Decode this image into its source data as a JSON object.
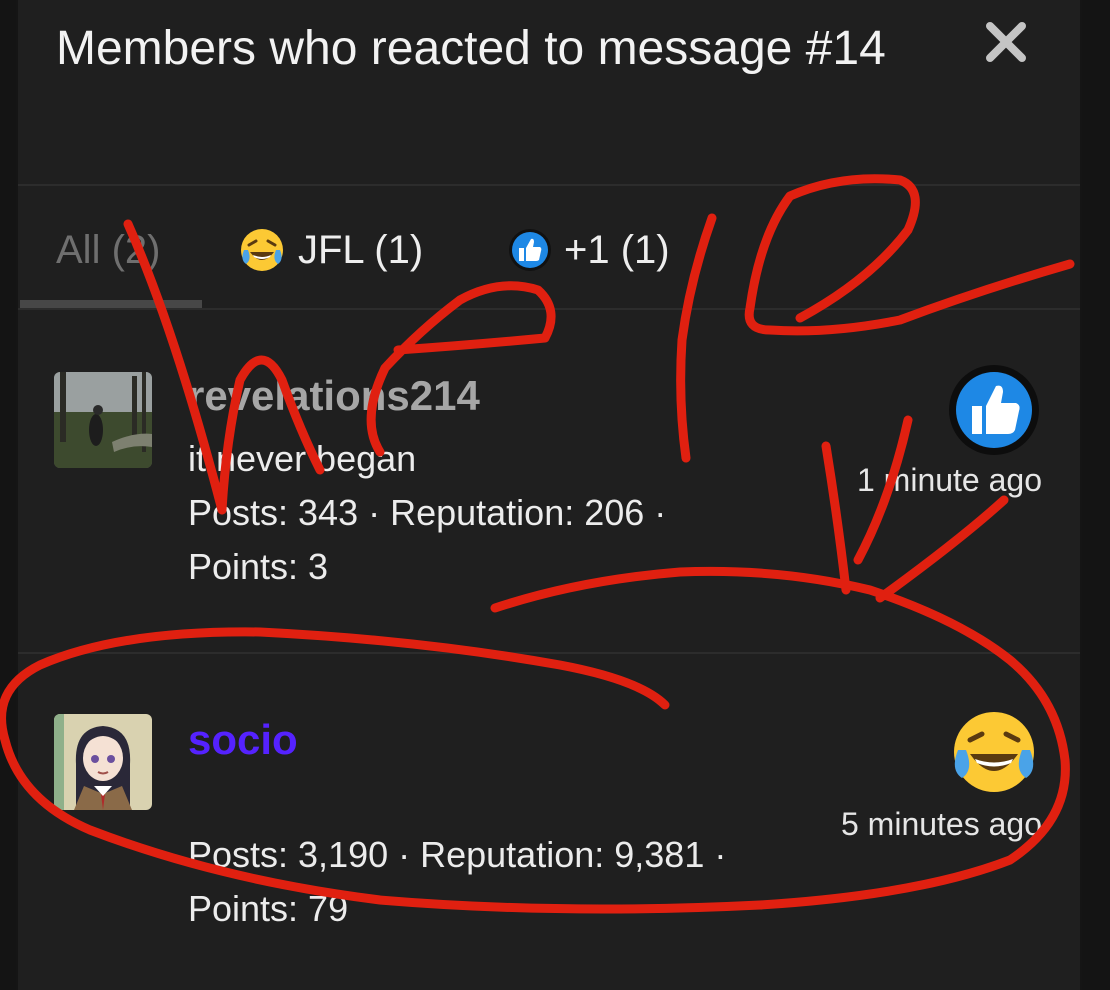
{
  "dialog": {
    "title": "Members who reacted to message #14",
    "close_icon": "close-icon"
  },
  "tabs": [
    {
      "label": "All (2)",
      "icon": null,
      "active": true
    },
    {
      "label": "JFL (1)",
      "icon": "crying-laughing-emoji-icon",
      "active": false
    },
    {
      "label": "+1 (1)",
      "icon": "thumbs-up-icon",
      "active": false
    }
  ],
  "members": [
    {
      "username": "revelations214",
      "tagline": "it never began",
      "stats_line1": "Posts: 343 · Reputation: 206 ·",
      "stats_line2": "Points: 3",
      "reaction_icon": "thumbs-up-icon",
      "time": "1 minute ago",
      "username_color": "#a6a6a6"
    },
    {
      "username": "socio",
      "tagline": "",
      "stats_line1": "Posts: 3,190 · Reputation: 9,381 ·",
      "stats_line2": "Points: 79",
      "reaction_icon": "crying-laughing-emoji-icon",
      "time": "5 minutes ago",
      "username_color": "#5522ff"
    }
  ],
  "annotation": {
    "color": "#e02010"
  }
}
